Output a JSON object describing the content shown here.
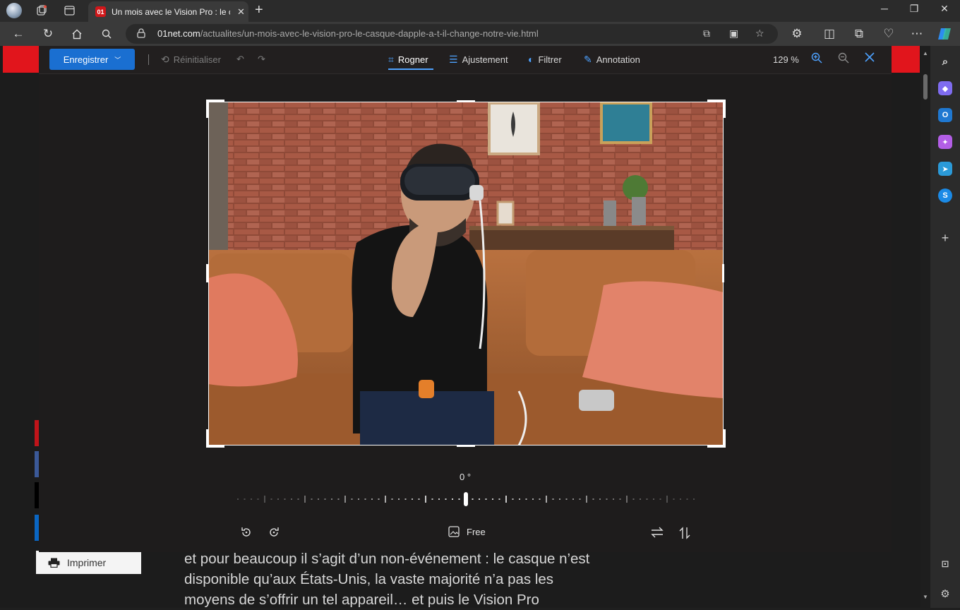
{
  "browser": {
    "tab_title": "Un mois avec le Vision Pro : le casque",
    "favicon_text": "01",
    "url_host": "01net.com",
    "url_path": "/actualites/un-mois-avec-le-vision-pro-le-casque-dapple-a-t-il-change-notre-vie.html"
  },
  "editor": {
    "save_label": "Enregistrer",
    "reset_label": "Réinitialiser",
    "tabs": {
      "crop": "Rogner",
      "adjust": "Ajustement",
      "filter": "Filtrer",
      "annotation": "Annotation"
    },
    "zoom": "129 %",
    "rotation": "0 °",
    "aspect": "Free",
    "accent_color": "#4ea2ff"
  },
  "page": {
    "print_label": "Imprimer",
    "article_lines": [
      "et pour beaucoup il s’agit d’un non-événement : le casque n’est",
      "disponible qu’aux États-Unis, la vaste majorité n’a pas les",
      "moyens de s’offrir un tel appareil… et puis le Vision Pro"
    ]
  }
}
